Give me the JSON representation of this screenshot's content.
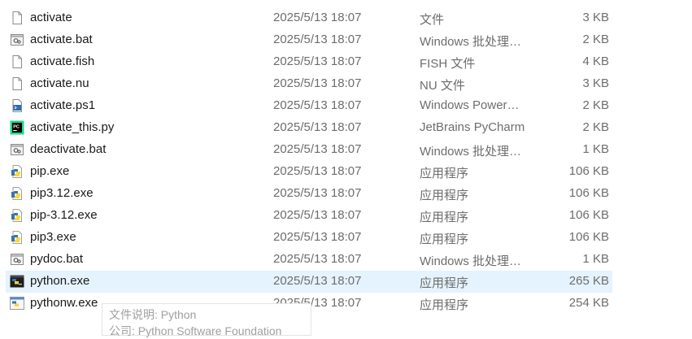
{
  "files": [
    {
      "name": "activate",
      "date": "2025/5/13 18:07",
      "type": "文件",
      "size": "3 KB",
      "icon": "blank-file-icon"
    },
    {
      "name": "activate.bat",
      "date": "2025/5/13 18:07",
      "type": "Windows 批处理…",
      "size": "2 KB",
      "icon": "batch-file-icon"
    },
    {
      "name": "activate.fish",
      "date": "2025/5/13 18:07",
      "type": "FISH 文件",
      "size": "4 KB",
      "icon": "blank-file-icon"
    },
    {
      "name": "activate.nu",
      "date": "2025/5/13 18:07",
      "type": "NU 文件",
      "size": "3 KB",
      "icon": "blank-file-icon"
    },
    {
      "name": "activate.ps1",
      "date": "2025/5/13 18:07",
      "type": "Windows Power…",
      "size": "2 KB",
      "icon": "powershell-file-icon"
    },
    {
      "name": "activate_this.py",
      "date": "2025/5/13 18:07",
      "type": "JetBrains PyCharm",
      "size": "2 KB",
      "icon": "pycharm-file-icon"
    },
    {
      "name": "deactivate.bat",
      "date": "2025/5/13 18:07",
      "type": "Windows 批处理…",
      "size": "1 KB",
      "icon": "batch-file-icon"
    },
    {
      "name": "pip.exe",
      "date": "2025/5/13 18:07",
      "type": "应用程序",
      "size": "106 KB",
      "icon": "python-exe-icon"
    },
    {
      "name": "pip3.12.exe",
      "date": "2025/5/13 18:07",
      "type": "应用程序",
      "size": "106 KB",
      "icon": "python-exe-icon"
    },
    {
      "name": "pip-3.12.exe",
      "date": "2025/5/13 18:07",
      "type": "应用程序",
      "size": "106 KB",
      "icon": "python-exe-icon"
    },
    {
      "name": "pip3.exe",
      "date": "2025/5/13 18:07",
      "type": "应用程序",
      "size": "106 KB",
      "icon": "python-exe-icon"
    },
    {
      "name": "pydoc.bat",
      "date": "2025/5/13 18:07",
      "type": "Windows 批处理…",
      "size": "1 KB",
      "icon": "batch-file-icon"
    },
    {
      "name": "python.exe",
      "date": "2025/5/13 18:07",
      "type": "应用程序",
      "size": "265 KB",
      "icon": "python-console-icon",
      "selected": true
    },
    {
      "name": "pythonw.exe",
      "date": "2025/5/13 18:07",
      "type": "应用程序",
      "size": "254 KB",
      "icon": "python-window-icon"
    }
  ],
  "tooltip": {
    "line1": "文件说明: Python",
    "line2": "公司: Python Software Foundation"
  },
  "colors": {
    "selection": "#e5f3ff",
    "python_blue": "#3776ab",
    "python_yellow": "#ffd43b",
    "pycharm_green": "#21d789",
    "secondary_text": "#6d6d6d"
  }
}
